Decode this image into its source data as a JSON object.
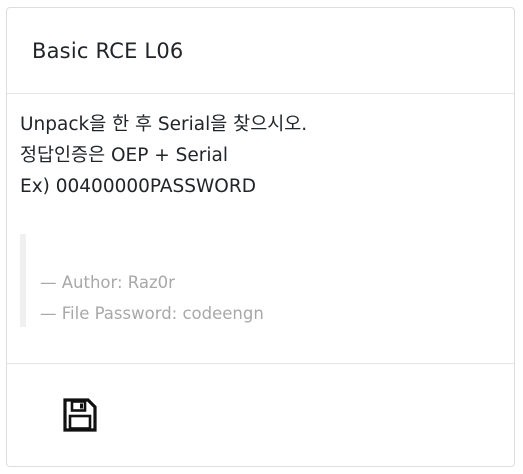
{
  "card": {
    "title": "Basic RCE L06",
    "description": [
      "Unpack을 한 후 Serial을 찾으시오.",
      "정답인증은 OEP + Serial",
      "Ex) 00400000PASSWORD"
    ],
    "quote": [
      "— Author: Raz0r",
      "— File Password: codeengn"
    ]
  },
  "footer": {
    "save_icon": "floppy-disk-icon"
  },
  "colors": {
    "border": "#dddddd",
    "text": "#212529",
    "muted": "#a8a8a8",
    "quote_bar": "#f0f0f0"
  }
}
